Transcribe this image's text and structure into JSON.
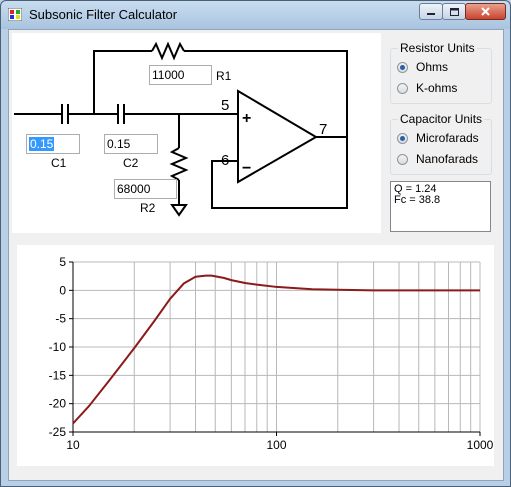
{
  "window": {
    "title": "Subsonic Filter Calculator"
  },
  "colors": {
    "curve": "#8b1a1a",
    "selection": "#3399ff"
  },
  "schematic": {
    "labels": {
      "r1": "R1",
      "r2": "R2",
      "c1": "C1",
      "c2": "C2",
      "pin5": "5",
      "pin6": "6",
      "pin7": "7",
      "plus": "+",
      "minus": "−"
    },
    "r1_value": "11000",
    "r2_value": "68000",
    "c1_value": "0.15",
    "c2_value": "0.15"
  },
  "resistor_units": {
    "title": "Resistor Units",
    "options": [
      "Ohms",
      "K-ohms"
    ],
    "selected": "Ohms"
  },
  "capacitor_units": {
    "title": "Capacitor Units",
    "options": [
      "Microfarads",
      "Nanofarads"
    ],
    "selected": "Microfarads"
  },
  "results": {
    "q_line": "Q = 1.24",
    "fc_line": "Fc = 38.8"
  },
  "chart_data": {
    "type": "line",
    "xscale": "log",
    "xlim": [
      10,
      1000
    ],
    "ylim": [
      -25,
      5
    ],
    "x_ticks": [
      "10",
      "100",
      "1000"
    ],
    "y_ticks": [
      "5",
      "0",
      "-5",
      "-10",
      "-15",
      "-20",
      "-25"
    ],
    "grid": true,
    "series": [
      {
        "x": [
          10,
          12,
          15,
          20,
          25,
          30,
          35,
          40,
          45,
          48,
          55,
          60,
          70,
          80,
          100,
          150,
          200,
          300,
          500,
          1000
        ],
        "y": [
          -23.5,
          -20.4,
          -16.0,
          -10.2,
          -5.5,
          -1.5,
          1.2,
          2.4,
          2.6,
          2.6,
          2.2,
          1.8,
          1.3,
          1.0,
          0.6,
          0.2,
          0.1,
          0.0,
          0.0,
          0.0
        ]
      }
    ]
  }
}
